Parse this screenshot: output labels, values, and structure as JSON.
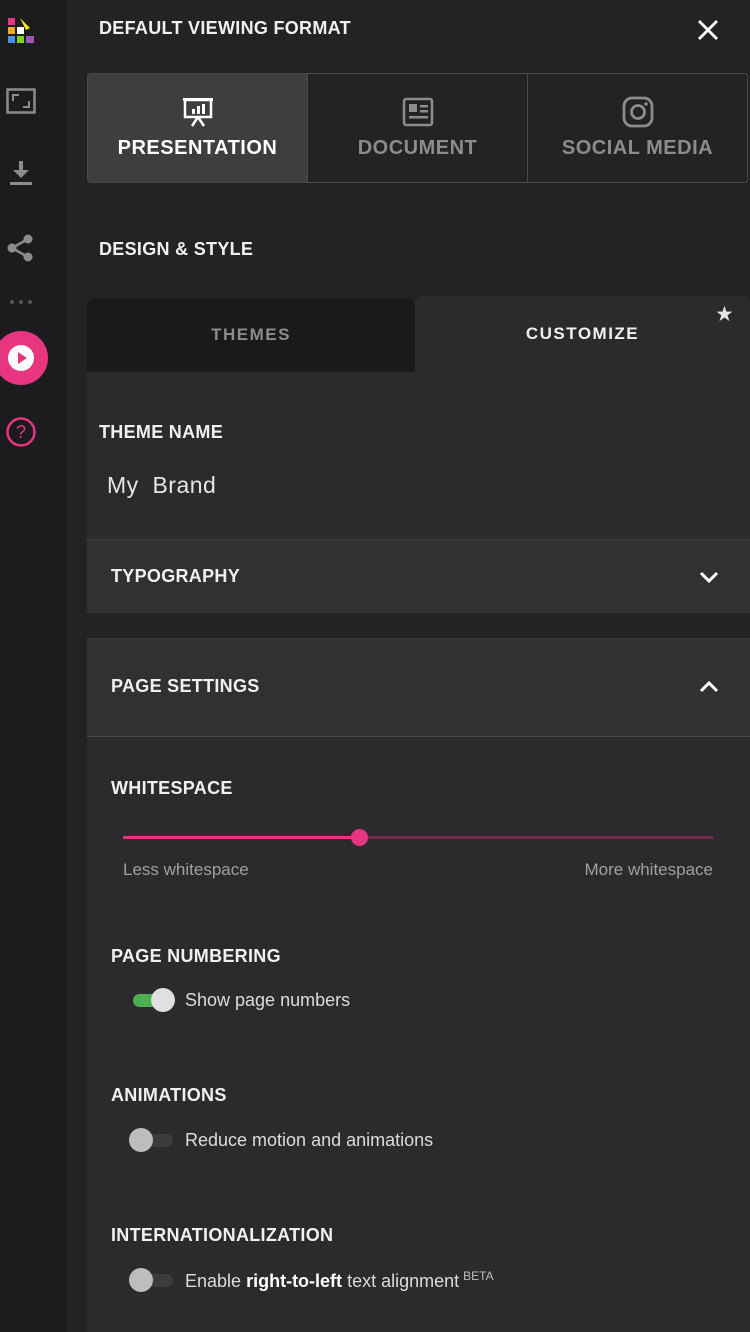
{
  "header": {
    "title": "DEFAULT VIEWING FORMAT"
  },
  "formats": [
    {
      "label": "PRESENTATION",
      "icon": "presentation-icon",
      "active": true
    },
    {
      "label": "DOCUMENT",
      "icon": "document-icon",
      "active": false
    },
    {
      "label": "SOCIAL MEDIA",
      "icon": "instagram-icon",
      "active": false
    }
  ],
  "design": {
    "label": "DESIGN & STYLE",
    "tabs": {
      "themes": "THEMES",
      "customize": "CUSTOMIZE",
      "active": "customize"
    }
  },
  "theme": {
    "label": "THEME NAME",
    "value": "My  Brand"
  },
  "typography": {
    "label": "TYPOGRAPHY",
    "expanded": false
  },
  "page_settings": {
    "label": "PAGE SETTINGS",
    "expanded": true,
    "whitespace": {
      "label": "WHITESPACE",
      "min_label": "Less whitespace",
      "max_label": "More whitespace",
      "level": 0.4
    },
    "page_numbering": {
      "label": "PAGE NUMBERING",
      "toggle_label": "Show page numbers",
      "on": true
    },
    "animations": {
      "label": "ANIMATIONS",
      "toggle_label": "Reduce motion and animations",
      "on": false
    },
    "i18n": {
      "label": "INTERNATIONALIZATION",
      "toggle_prefix": "Enable",
      "toggle_bold": "right-to-left",
      "toggle_suffix": "text alignment",
      "badge": "BETA",
      "on": false
    }
  },
  "colors": {
    "accent": "#e8357f",
    "toggle_on": "#4caf50",
    "background": "#232325"
  }
}
